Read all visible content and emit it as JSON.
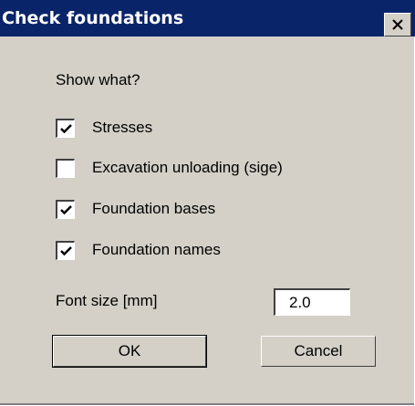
{
  "window": {
    "title": "Check foundations",
    "close_icon": "close-icon"
  },
  "section_label": "Show what?",
  "options": [
    {
      "label": "Stresses",
      "checked": true
    },
    {
      "label": "Excavation unloading (sige)",
      "checked": false
    },
    {
      "label": "Foundation bases",
      "checked": true
    },
    {
      "label": "Foundation names",
      "checked": true
    }
  ],
  "font_size": {
    "label": "Font size [mm]",
    "value": "2.0"
  },
  "buttons": {
    "ok_label": "OK",
    "cancel_label": "Cancel"
  },
  "colors": {
    "titlebar": "#0a246a",
    "dialog_face": "#d4d0c8"
  }
}
